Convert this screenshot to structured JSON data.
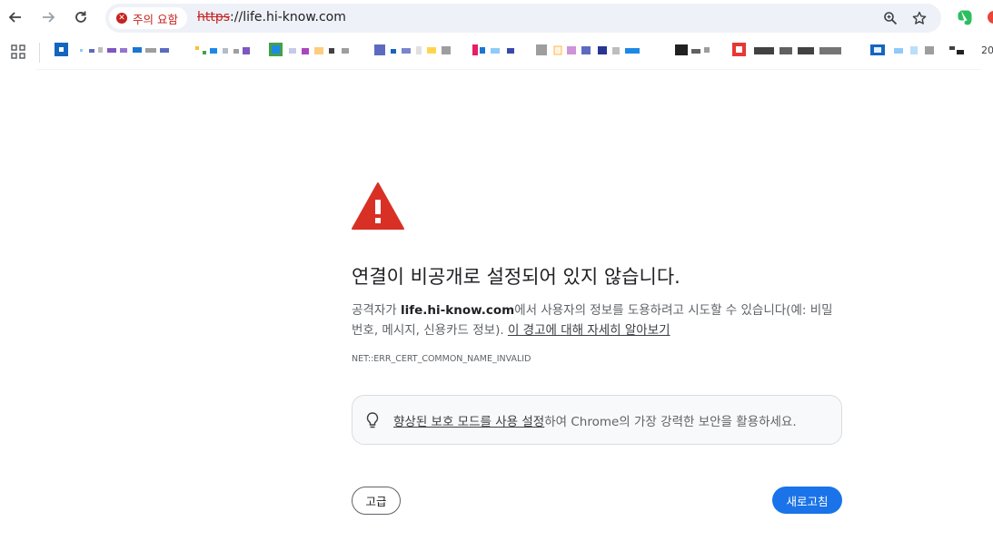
{
  "toolbar": {
    "back_icon": "arrow-left-icon",
    "forward_icon": "arrow-right-icon",
    "reload_icon": "reload-icon",
    "security_chip_label": "주의 요함",
    "url_scheme": "https",
    "url_rest": "://life.hi-know.com",
    "zoom_icon": "zoom-icon",
    "bookmark_star_icon": "star-icon"
  },
  "bookmarks_bar": {
    "apps_icon": "apps-grid-icon",
    "trailing_text": "20"
  },
  "interstitial": {
    "heading": "연결이 비공개로 설정되어 있지 않습니다.",
    "desc_prefix": "공격자가 ",
    "desc_host": "life.hi-know.com",
    "desc_suffix": "에서 사용자의 정보를 도용하려고 시도할 수 있습니다(예: 비밀번호, 메시지, 신용카드 정보). ",
    "learn_more_link": "이 경고에 대해 자세히 알아보기",
    "error_code": "NET::ERR_CERT_COMMON_NAME_INVALID",
    "banner_link": "향상된 보호 모드를 사용 설정",
    "banner_suffix": "하여 Chrome의 가장 강력한 보안을 활용하세요.",
    "advanced_button": "고급",
    "reload_button": "새로고침"
  },
  "colors": {
    "danger": "#c5221f",
    "warning_triangle": "#d93025",
    "primary_button": "#1a73e8",
    "omnibox_bg": "#eef1f7"
  }
}
